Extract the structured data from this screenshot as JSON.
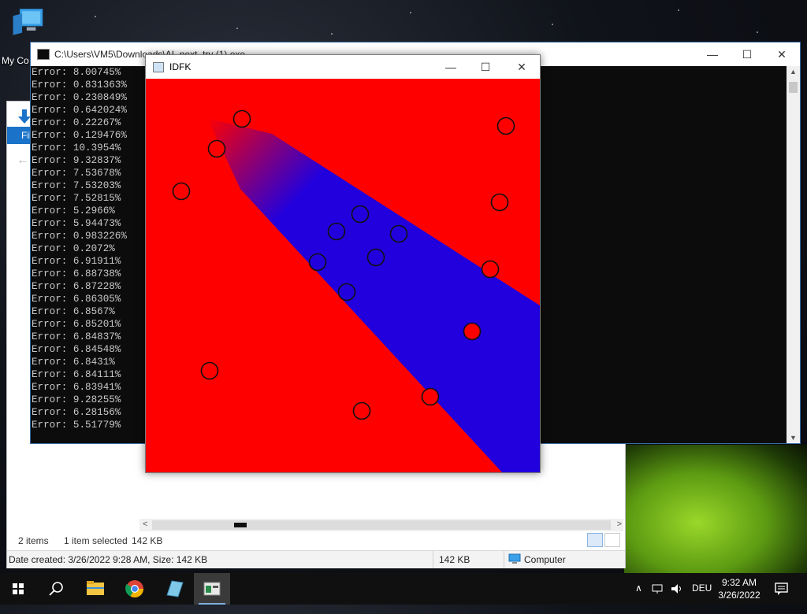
{
  "desktop": {
    "icon_label": "My Co"
  },
  "explorer": {
    "ribbon_file": "Fil",
    "status_items": "2 items",
    "status_selected": "1 item selected",
    "status_size": "142 KB",
    "details_text": "Date created: 3/26/2022 9:28 AM, Size: 142 KB",
    "details_size": "142 KB",
    "details_location": "Computer"
  },
  "console": {
    "title": "C:\\Users\\VM5\\Downloads\\AI_next_try (1).exe",
    "lines": [
      "Error: 8.00745%",
      "Error: 0.831363%",
      "Error: 0.230849%",
      "Error: 0.642024%",
      "Error: 0.22267%",
      "Error: 0.129476%",
      "Error: 10.3954%",
      "Error: 9.32837%",
      "Error: 7.53678%",
      "Error: 7.53203%",
      "Error: 7.52815%",
      "Error: 5.2966%",
      "Error: 5.94473%",
      "Error: 0.983226%",
      "Error: 0.2072%",
      "Error: 6.91911%",
      "Error: 6.88738%",
      "Error: 6.87228%",
      "Error: 6.86305%",
      "Error: 6.8567%",
      "Error: 6.85201%",
      "Error: 6.84837%",
      "Error: 6.84548%",
      "Error: 6.8431%",
      "Error: 6.84111%",
      "Error: 6.83941%",
      "Error: 9.28255%",
      "Error: 6.28156%",
      "Error: 5.51779%"
    ]
  },
  "idfk_window": {
    "title": "IDFK",
    "colors": {
      "class_red": "#ff0000",
      "class_blue": "#2200dd"
    }
  },
  "taskbar": {
    "language": "DEU",
    "time": "9:32 AM",
    "date": "3/26/2022",
    "apps": [
      "start-icon",
      "search-icon",
      "file-explorer-icon",
      "chrome-icon",
      "notepad-icon",
      "console-app-icon"
    ]
  }
}
